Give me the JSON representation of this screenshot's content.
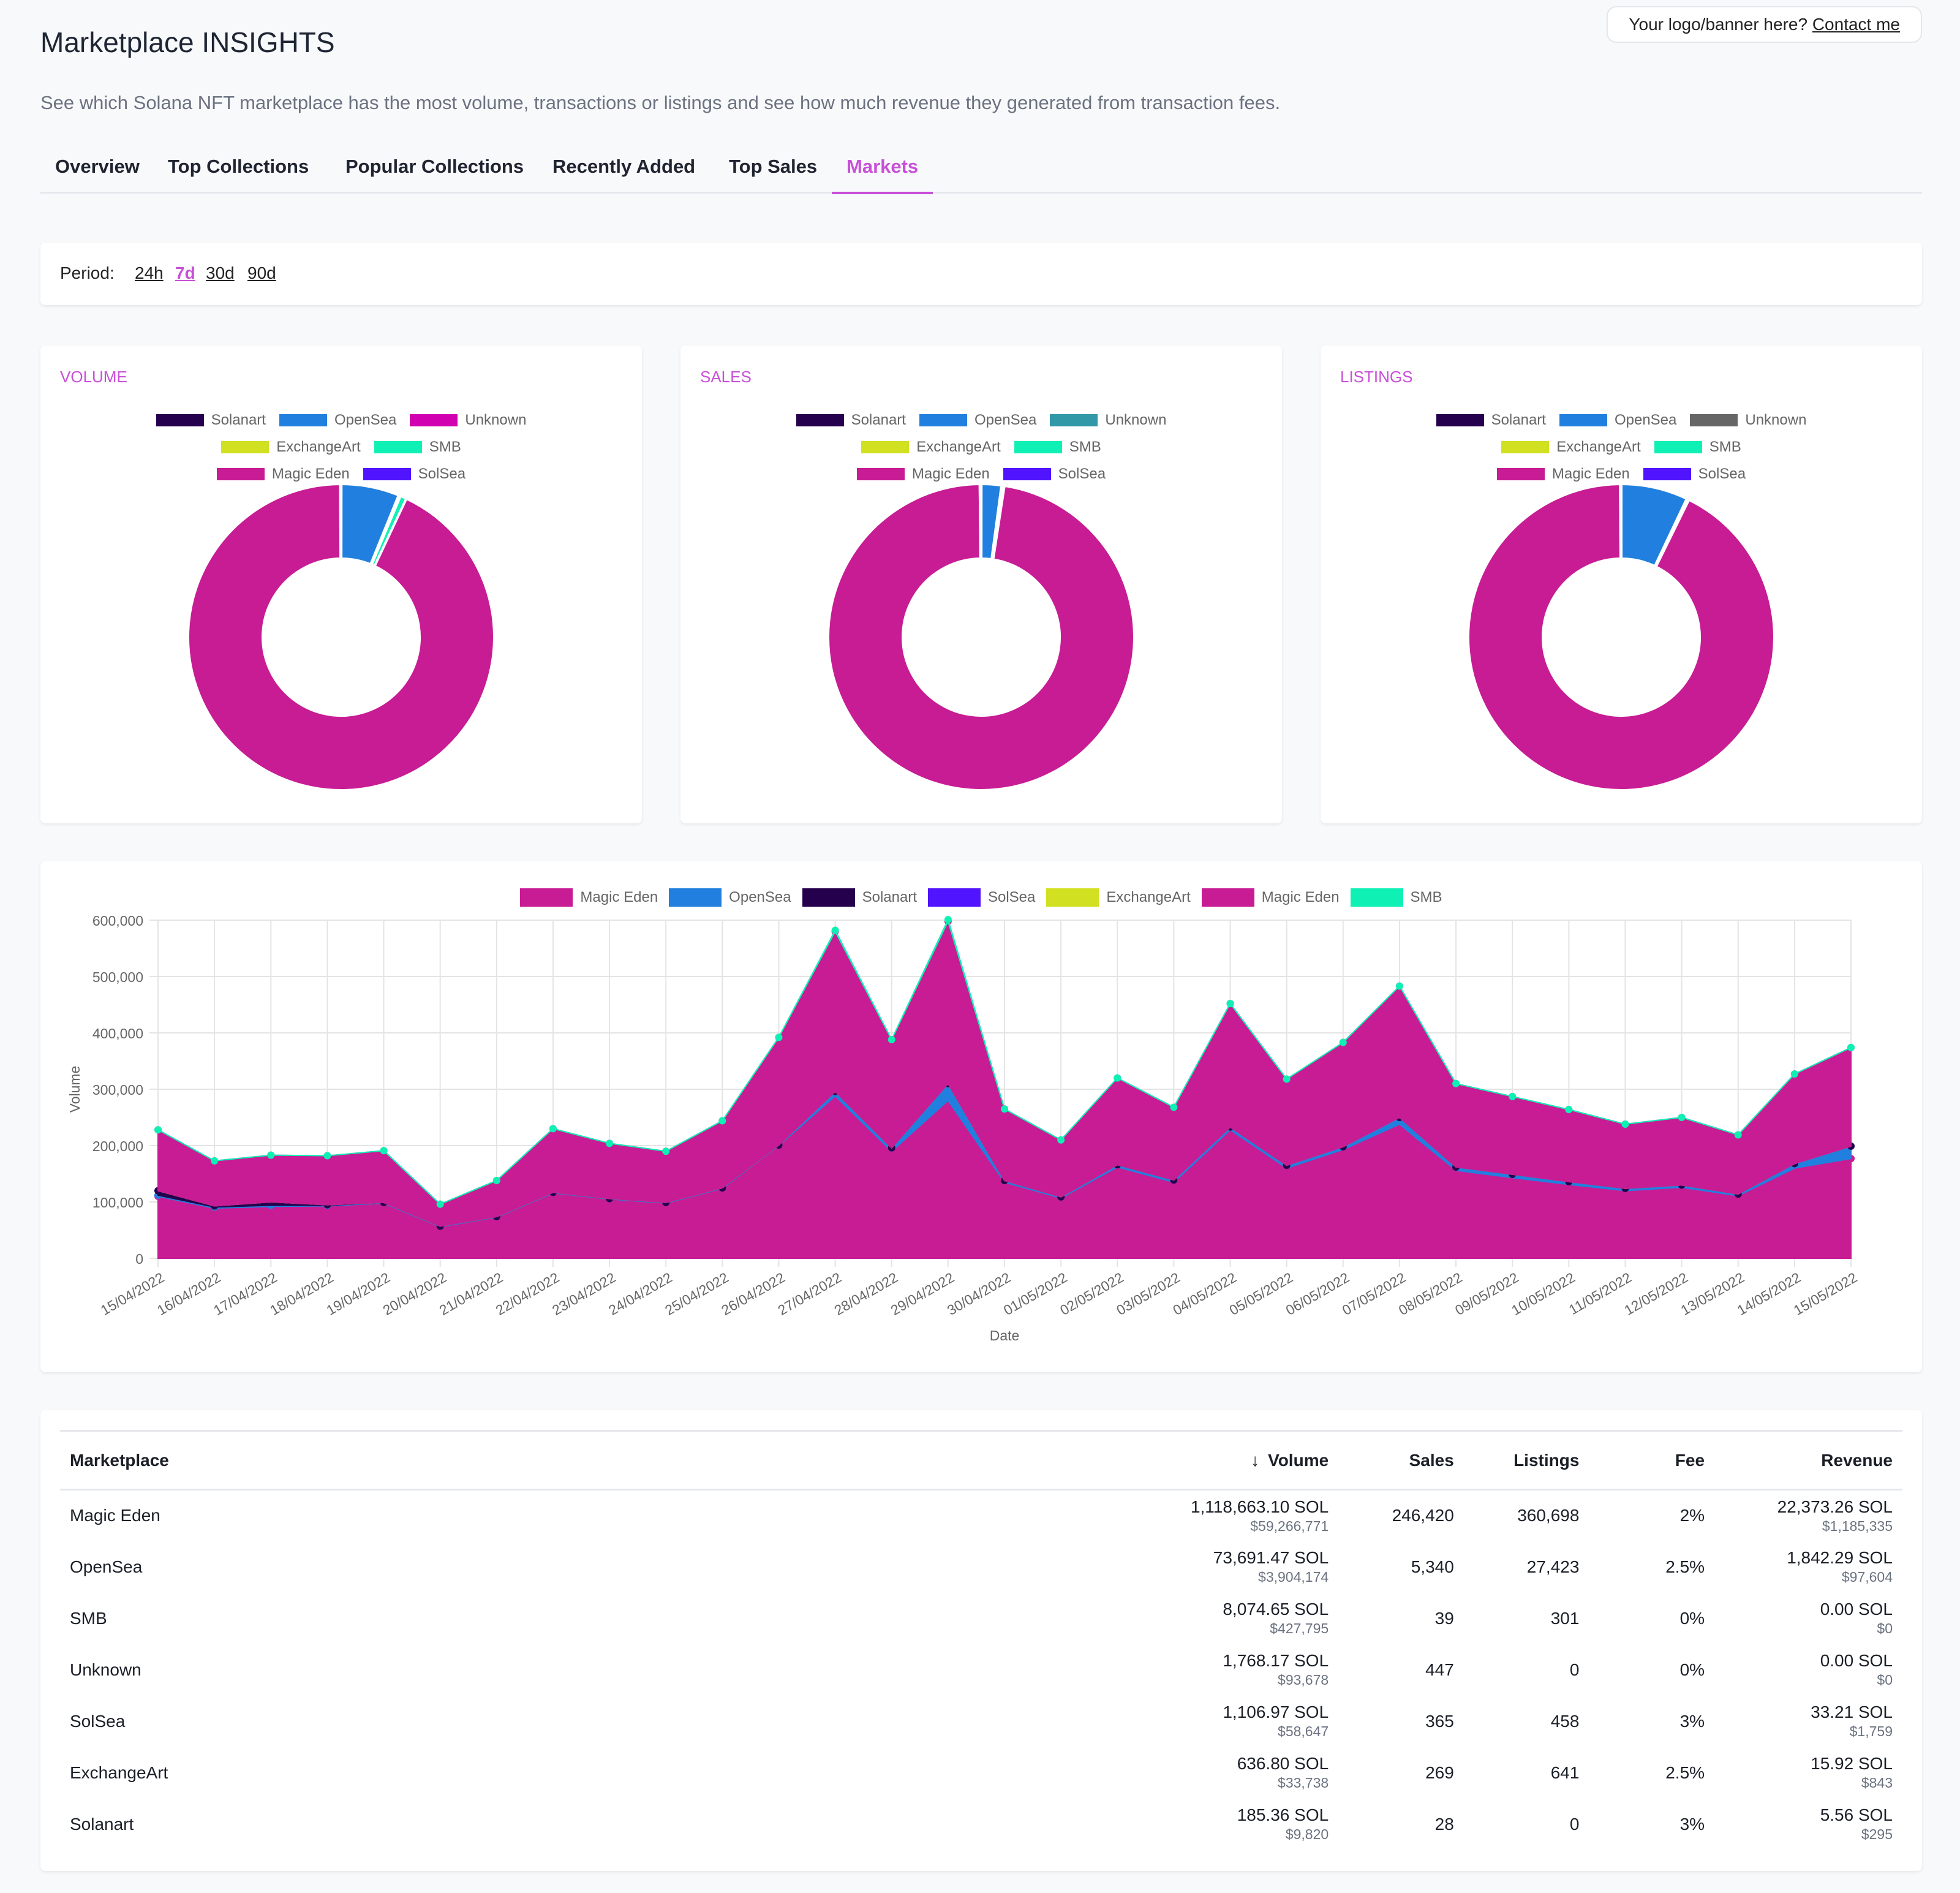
{
  "banner": {
    "text": "Your logo/banner here?",
    "link": "Contact me"
  },
  "header": {
    "title": "Marketplace INSIGHTS",
    "subtitle": "See which Solana NFT marketplace has the most volume, transactions or listings and see how much revenue they generated from transaction fees."
  },
  "tabs": [
    {
      "label": "Overview",
      "active": false
    },
    {
      "label": "Top Collections",
      "active": false
    },
    {
      "label": "Popular Collections",
      "active": false
    },
    {
      "label": "Recently Added",
      "active": false
    },
    {
      "label": "Top Sales",
      "active": false
    },
    {
      "label": "Markets",
      "active": true
    }
  ],
  "period": {
    "label": "Period:",
    "options": [
      "24h",
      "7d",
      "30d",
      "90d"
    ],
    "selected": "7d"
  },
  "colors": {
    "accent": "#c84fd8",
    "Solanart": "#24004d",
    "OpenSea": "#2180df",
    "Unknown_volume": "#d100b0",
    "Unknown_sales": "#3198a8",
    "Unknown_listings": "#666666",
    "ExchangeArt": "#d1e021",
    "SMB": "#0ff0b4",
    "Magic Eden": "#c71c94",
    "SolSea": "#5014ff"
  },
  "chart_data": [
    {
      "type": "pie",
      "title": "VOLUME",
      "donut": true,
      "legend": [
        "Solanart",
        "OpenSea",
        "Unknown",
        "ExchangeArt",
        "SMB",
        "Magic Eden",
        "SolSea"
      ],
      "legend_colors": [
        "#24004d",
        "#2180df",
        "#d100b0",
        "#d1e021",
        "#0ff0b4",
        "#c71c94",
        "#5014ff"
      ],
      "values": [
        185.36,
        73691.47,
        1768.17,
        636.8,
        8074.65,
        1118663.1,
        1106.97
      ]
    },
    {
      "type": "pie",
      "title": "SALES",
      "donut": true,
      "legend": [
        "Solanart",
        "OpenSea",
        "Unknown",
        "ExchangeArt",
        "SMB",
        "Magic Eden",
        "SolSea"
      ],
      "legend_colors": [
        "#24004d",
        "#2180df",
        "#3198a8",
        "#d1e021",
        "#0ff0b4",
        "#c71c94",
        "#5014ff"
      ],
      "values": [
        28,
        5340,
        447,
        269,
        39,
        246420,
        365
      ]
    },
    {
      "type": "pie",
      "title": "LISTINGS",
      "donut": true,
      "legend": [
        "Solanart",
        "OpenSea",
        "Unknown",
        "ExchangeArt",
        "SMB",
        "Magic Eden",
        "SolSea"
      ],
      "legend_colors": [
        "#24004d",
        "#2180df",
        "#666666",
        "#d1e021",
        "#0ff0b4",
        "#c71c94",
        "#5014ff"
      ],
      "values": [
        0,
        27423,
        0,
        641,
        301,
        360698,
        458
      ]
    },
    {
      "type": "area",
      "title": "",
      "xlabel": "Date",
      "ylabel": "Volume",
      "ylim": [
        0,
        600000
      ],
      "yticks": [
        "0",
        "100,000",
        "200,000",
        "300,000",
        "400,000",
        "500,000",
        "600,000"
      ],
      "grid": true,
      "legend_position": "top",
      "legend": [
        {
          "name": "Magic Eden",
          "color": "#c71c94"
        },
        {
          "name": "OpenSea",
          "color": "#2180df"
        },
        {
          "name": "Solanart",
          "color": "#24004d"
        },
        {
          "name": "SolSea",
          "color": "#5014ff"
        },
        {
          "name": "ExchangeArt",
          "color": "#d1e021"
        },
        {
          "name": "Magic Eden",
          "color": "#c71c94"
        },
        {
          "name": "SMB",
          "color": "#0ff0b4"
        }
      ],
      "x": [
        "15/04/2022",
        "16/04/2022",
        "17/04/2022",
        "18/04/2022",
        "19/04/2022",
        "20/04/2022",
        "21/04/2022",
        "22/04/2022",
        "23/04/2022",
        "24/04/2022",
        "25/04/2022",
        "26/04/2022",
        "27/04/2022",
        "28/04/2022",
        "29/04/2022",
        "30/04/2022",
        "01/05/2022",
        "02/05/2022",
        "03/05/2022",
        "04/05/2022",
        "05/05/2022",
        "06/05/2022",
        "07/05/2022",
        "08/05/2022",
        "09/05/2022",
        "10/05/2022",
        "11/05/2022",
        "12/05/2022",
        "13/05/2022",
        "14/05/2022",
        "15/05/2022"
      ],
      "series": [
        {
          "name": "Magic Eden",
          "color": "#c71c94",
          "values": [
            110000,
            89000,
            92000,
            93000,
            98000,
            56000,
            73000,
            116000,
            105000,
            98000,
            124000,
            200000,
            288000,
            190000,
            280000,
            135000,
            107000,
            162000,
            135000,
            228000,
            160000,
            193000,
            238000,
            156000,
            143000,
            131000,
            120000,
            126000,
            111000,
            160000,
            177000
          ]
        },
        {
          "name": "OpenSea",
          "color": "#2180df",
          "values": [
            2000,
            2000,
            2000,
            1000,
            1000,
            1000,
            1000,
            1000,
            1000,
            1000,
            1000,
            1000,
            8000,
            6000,
            30000,
            3000,
            2000,
            4000,
            4000,
            5000,
            5000,
            5000,
            12000,
            6000,
            6000,
            5000,
            4000,
            4000,
            3000,
            8000,
            22000
          ]
        },
        {
          "name": "Solanart",
          "color": "#24004d",
          "values": [
            8000,
            2000,
            6000,
            1000,
            0,
            0,
            0,
            0,
            0,
            0,
            0,
            0,
            0,
            0,
            0,
            0,
            0,
            0,
            0,
            0,
            0,
            0,
            0,
            0,
            0,
            0,
            0,
            0,
            0,
            0,
            0
          ]
        },
        {
          "name": "SolSea",
          "color": "#5014ff",
          "values": [
            0,
            0,
            0,
            0,
            0,
            0,
            0,
            0,
            0,
            0,
            0,
            0,
            0,
            0,
            0,
            0,
            0,
            0,
            0,
            0,
            0,
            0,
            0,
            0,
            0,
            0,
            0,
            0,
            0,
            0,
            0
          ]
        },
        {
          "name": "ExchangeArt",
          "color": "#d1e021",
          "values": [
            0,
            0,
            0,
            0,
            0,
            0,
            0,
            0,
            0,
            0,
            0,
            0,
            0,
            0,
            0,
            0,
            0,
            0,
            0,
            0,
            0,
            0,
            0,
            0,
            0,
            0,
            0,
            0,
            0,
            0,
            0
          ]
        },
        {
          "name": "Magic Eden",
          "color": "#c71c94",
          "values": [
            108000,
            80000,
            83000,
            87000,
            92000,
            39000,
            64000,
            113000,
            98000,
            91000,
            119000,
            191000,
            284000,
            192000,
            288000,
            127000,
            101000,
            154000,
            129000,
            219000,
            153000,
            185000,
            233000,
            148000,
            138000,
            128000,
            114000,
            120000,
            105000,
            159000,
            175000
          ]
        },
        {
          "name": "SMB",
          "color": "#0ff0b4",
          "values": [
            0,
            0,
            0,
            0,
            0,
            0,
            0,
            0,
            0,
            0,
            0,
            0,
            2000,
            0,
            3000,
            0,
            0,
            0,
            0,
            0,
            0,
            0,
            0,
            0,
            0,
            0,
            0,
            0,
            0,
            0,
            0
          ]
        }
      ]
    }
  ],
  "table": {
    "columns": [
      {
        "label": "Marketplace",
        "sort": ""
      },
      {
        "label": "Volume",
        "sort": "desc"
      },
      {
        "label": "Sales",
        "sort": ""
      },
      {
        "label": "Listings",
        "sort": ""
      },
      {
        "label": "Fee",
        "sort": ""
      },
      {
        "label": "Revenue",
        "sort": ""
      }
    ],
    "rows": [
      {
        "name": "Magic Eden",
        "volume_sol": "1,118,663.10 SOL",
        "volume_usd": "$59,266,771",
        "sales": "246,420",
        "listings": "360,698",
        "fee": "2%",
        "revenue_sol": "22,373.26 SOL",
        "revenue_usd": "$1,185,335"
      },
      {
        "name": "OpenSea",
        "volume_sol": "73,691.47 SOL",
        "volume_usd": "$3,904,174",
        "sales": "5,340",
        "listings": "27,423",
        "fee": "2.5%",
        "revenue_sol": "1,842.29 SOL",
        "revenue_usd": "$97,604"
      },
      {
        "name": "SMB",
        "volume_sol": "8,074.65 SOL",
        "volume_usd": "$427,795",
        "sales": "39",
        "listings": "301",
        "fee": "0%",
        "revenue_sol": "0.00 SOL",
        "revenue_usd": "$0"
      },
      {
        "name": "Unknown",
        "volume_sol": "1,768.17 SOL",
        "volume_usd": "$93,678",
        "sales": "447",
        "listings": "0",
        "fee": "0%",
        "revenue_sol": "0.00 SOL",
        "revenue_usd": "$0"
      },
      {
        "name": "SolSea",
        "volume_sol": "1,106.97 SOL",
        "volume_usd": "$58,647",
        "sales": "365",
        "listings": "458",
        "fee": "3%",
        "revenue_sol": "33.21 SOL",
        "revenue_usd": "$1,759"
      },
      {
        "name": "ExchangeArt",
        "volume_sol": "636.80 SOL",
        "volume_usd": "$33,738",
        "sales": "269",
        "listings": "641",
        "fee": "2.5%",
        "revenue_sol": "15.92 SOL",
        "revenue_usd": "$843"
      },
      {
        "name": "Solanart",
        "volume_sol": "185.36 SOL",
        "volume_usd": "$9,820",
        "sales": "28",
        "listings": "0",
        "fee": "3%",
        "revenue_sol": "5.56 SOL",
        "revenue_usd": "$295"
      }
    ]
  }
}
